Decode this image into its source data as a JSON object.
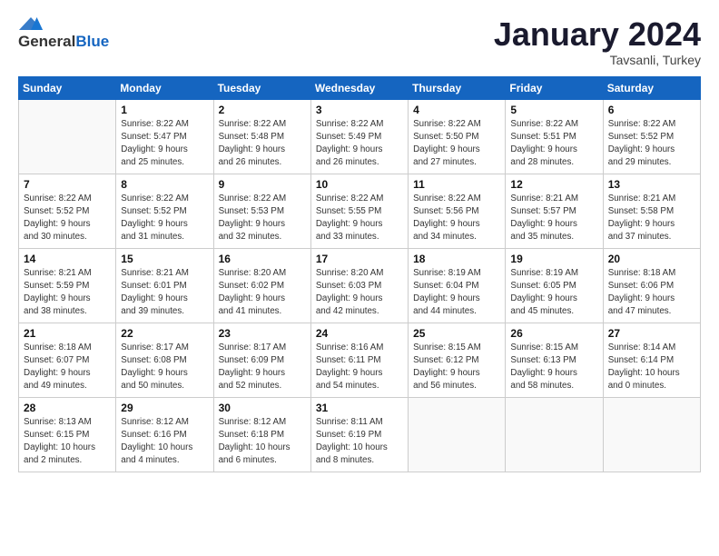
{
  "header": {
    "logo_general": "General",
    "logo_blue": "Blue",
    "month_title": "January 2024",
    "subtitle": "Tavsanli, Turkey"
  },
  "weekdays": [
    "Sunday",
    "Monday",
    "Tuesday",
    "Wednesday",
    "Thursday",
    "Friday",
    "Saturday"
  ],
  "weeks": [
    [
      {
        "day": "",
        "info": ""
      },
      {
        "day": "1",
        "info": "Sunrise: 8:22 AM\nSunset: 5:47 PM\nDaylight: 9 hours\nand 25 minutes."
      },
      {
        "day": "2",
        "info": "Sunrise: 8:22 AM\nSunset: 5:48 PM\nDaylight: 9 hours\nand 26 minutes."
      },
      {
        "day": "3",
        "info": "Sunrise: 8:22 AM\nSunset: 5:49 PM\nDaylight: 9 hours\nand 26 minutes."
      },
      {
        "day": "4",
        "info": "Sunrise: 8:22 AM\nSunset: 5:50 PM\nDaylight: 9 hours\nand 27 minutes."
      },
      {
        "day": "5",
        "info": "Sunrise: 8:22 AM\nSunset: 5:51 PM\nDaylight: 9 hours\nand 28 minutes."
      },
      {
        "day": "6",
        "info": "Sunrise: 8:22 AM\nSunset: 5:52 PM\nDaylight: 9 hours\nand 29 minutes."
      }
    ],
    [
      {
        "day": "7",
        "info": ""
      },
      {
        "day": "8",
        "info": "Sunrise: 8:22 AM\nSunset: 5:52 PM\nDaylight: 9 hours\nand 31 minutes."
      },
      {
        "day": "9",
        "info": "Sunrise: 8:22 AM\nSunset: 5:53 PM\nDaylight: 9 hours\nand 32 minutes."
      },
      {
        "day": "10",
        "info": "Sunrise: 8:22 AM\nSunset: 5:55 PM\nDaylight: 9 hours\nand 33 minutes."
      },
      {
        "day": "11",
        "info": "Sunrise: 8:22 AM\nSunset: 5:56 PM\nDaylight: 9 hours\nand 34 minutes."
      },
      {
        "day": "12",
        "info": "Sunrise: 8:21 AM\nSunset: 5:57 PM\nDaylight: 9 hours\nand 35 minutes."
      },
      {
        "day": "13",
        "info": "Sunrise: 8:21 AM\nSunset: 5:58 PM\nDaylight: 9 hours\nand 37 minutes."
      }
    ],
    [
      {
        "day": "14",
        "info": ""
      },
      {
        "day": "15",
        "info": "Sunrise: 8:21 AM\nSunset: 6:01 PM\nDaylight: 9 hours\nand 39 minutes."
      },
      {
        "day": "16",
        "info": "Sunrise: 8:20 AM\nSunset: 6:02 PM\nDaylight: 9 hours\nand 41 minutes."
      },
      {
        "day": "17",
        "info": "Sunrise: 8:20 AM\nSunset: 6:03 PM\nDaylight: 9 hours\nand 42 minutes."
      },
      {
        "day": "18",
        "info": "Sunrise: 8:19 AM\nSunset: 6:04 PM\nDaylight: 9 hours\nand 44 minutes."
      },
      {
        "day": "19",
        "info": "Sunrise: 8:19 AM\nSunset: 6:05 PM\nDaylight: 9 hours\nand 45 minutes."
      },
      {
        "day": "20",
        "info": "Sunrise: 8:18 AM\nSunset: 6:06 PM\nDaylight: 9 hours\nand 47 minutes."
      }
    ],
    [
      {
        "day": "21",
        "info": ""
      },
      {
        "day": "22",
        "info": "Sunrise: 8:17 AM\nSunset: 6:08 PM\nDaylight: 9 hours\nand 50 minutes."
      },
      {
        "day": "23",
        "info": "Sunrise: 8:17 AM\nSunset: 6:09 PM\nDaylight: 9 hours\nand 52 minutes."
      },
      {
        "day": "24",
        "info": "Sunrise: 8:16 AM\nSunset: 6:11 PM\nDaylight: 9 hours\nand 54 minutes."
      },
      {
        "day": "25",
        "info": "Sunrise: 8:15 AM\nSunset: 6:12 PM\nDaylight: 9 hours\nand 56 minutes."
      },
      {
        "day": "26",
        "info": "Sunrise: 8:15 AM\nSunset: 6:13 PM\nDaylight: 9 hours\nand 58 minutes."
      },
      {
        "day": "27",
        "info": "Sunrise: 8:14 AM\nSunset: 6:14 PM\nDaylight: 10 hours\nand 0 minutes."
      }
    ],
    [
      {
        "day": "28",
        "info": "Sunrise: 8:13 AM\nSunset: 6:15 PM\nDaylight: 10 hours\nand 2 minutes."
      },
      {
        "day": "29",
        "info": "Sunrise: 8:12 AM\nSunset: 6:16 PM\nDaylight: 10 hours\nand 4 minutes."
      },
      {
        "day": "30",
        "info": "Sunrise: 8:12 AM\nSunset: 6:18 PM\nDaylight: 10 hours\nand 6 minutes."
      },
      {
        "day": "31",
        "info": "Sunrise: 8:11 AM\nSunset: 6:19 PM\nDaylight: 10 hours\nand 8 minutes."
      },
      {
        "day": "",
        "info": ""
      },
      {
        "day": "",
        "info": ""
      },
      {
        "day": "",
        "info": ""
      }
    ]
  ],
  "week1_sunday_info": "Sunrise: 8:22 AM\nSunset: 5:52 PM\nDaylight: 9 hours\nand 30 minutes.",
  "week3_sunday_info": "Sunrise: 8:21 AM\nSunset: 5:59 PM\nDaylight: 9 hours\nand 38 minutes.",
  "week4_sunday_info": "Sunrise: 8:18 AM\nSunset: 6:07 PM\nDaylight: 9 hours\nand 49 minutes."
}
